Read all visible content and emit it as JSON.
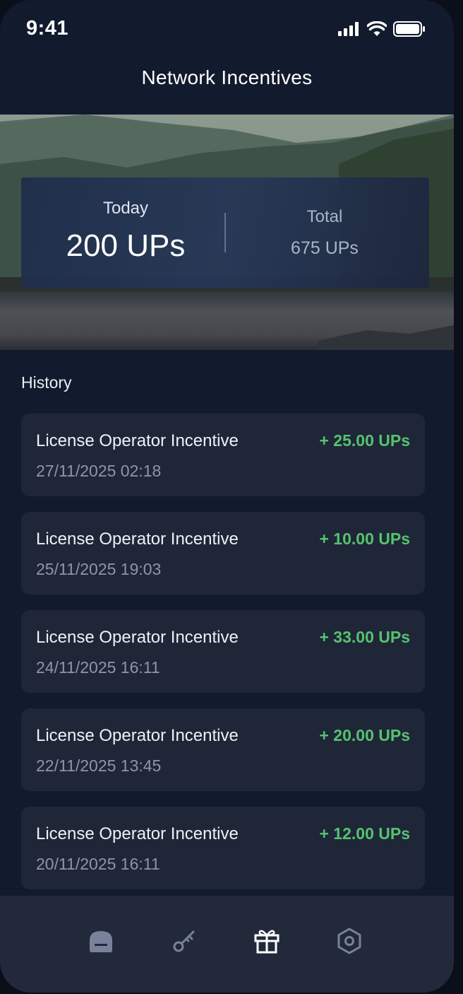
{
  "status": {
    "time": "9:41"
  },
  "header": {
    "title": "Network Incentives"
  },
  "stats": {
    "today_label": "Today",
    "today_value": "200 UPs",
    "total_label": "Total",
    "total_value": "675 UPs"
  },
  "history": {
    "title": "History",
    "items": [
      {
        "title": "License Operator Incentive",
        "date": "27/11/2025 02:18",
        "amount": "+ 25.00 UPs"
      },
      {
        "title": "License Operator Incentive",
        "date": "25/11/2025 19:03",
        "amount": "+ 10.00 UPs"
      },
      {
        "title": "License Operator Incentive",
        "date": "24/11/2025 16:11",
        "amount": "+ 33.00 UPs"
      },
      {
        "title": "License Operator Incentive",
        "date": "22/11/2025 13:45",
        "amount": "+ 20.00 UPs"
      },
      {
        "title": "License Operator Incentive",
        "date": "20/11/2025 16:11",
        "amount": "+ 12.00 UPs"
      }
    ]
  },
  "nav": {
    "items": [
      {
        "icon": "home-icon",
        "active": false
      },
      {
        "icon": "key-icon",
        "active": false
      },
      {
        "icon": "gift-icon",
        "active": true
      },
      {
        "icon": "settings-icon",
        "active": false
      }
    ]
  },
  "colors": {
    "background": "#121a2d",
    "card": "#1f2638",
    "accent_green": "#56c26f",
    "nav_bg": "#22293a"
  }
}
